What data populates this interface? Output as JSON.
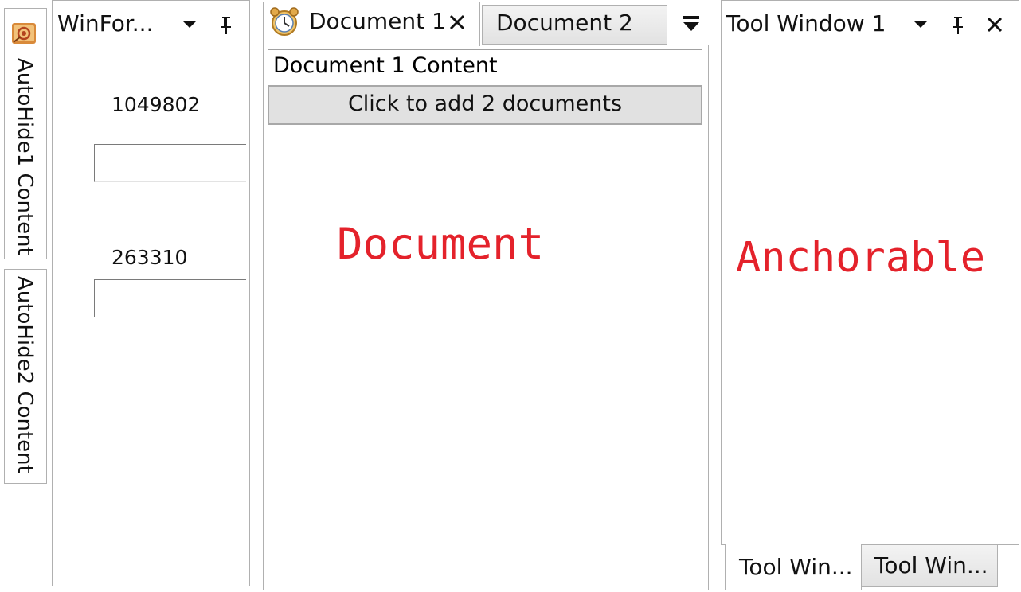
{
  "auto_hide": {
    "tab1_label": "AutoHide1 Content",
    "tab2_label": "AutoHide2 Content"
  },
  "winforms_pane": {
    "title": "WinFor...",
    "value1": "1049802",
    "value2": "263310"
  },
  "document_pane": {
    "tabs": [
      {
        "label": "Document 1",
        "icon": "alarm-clock-icon",
        "active": true
      },
      {
        "label": "Document 2",
        "active": false
      }
    ],
    "content_text": "Document 1 Content",
    "add_button_label": "Click to add 2 documents",
    "watermark": "Document"
  },
  "tool_pane": {
    "title": "Tool Window 1",
    "watermark": "Anchorable",
    "bottom_tabs": [
      {
        "label": "Tool Win...",
        "active": true
      },
      {
        "label": "Tool Win...",
        "active": false
      }
    ]
  },
  "colors": {
    "accent_red": "#e4222b",
    "border": "#b0b0b0",
    "button_face": "#e1e1e1"
  }
}
